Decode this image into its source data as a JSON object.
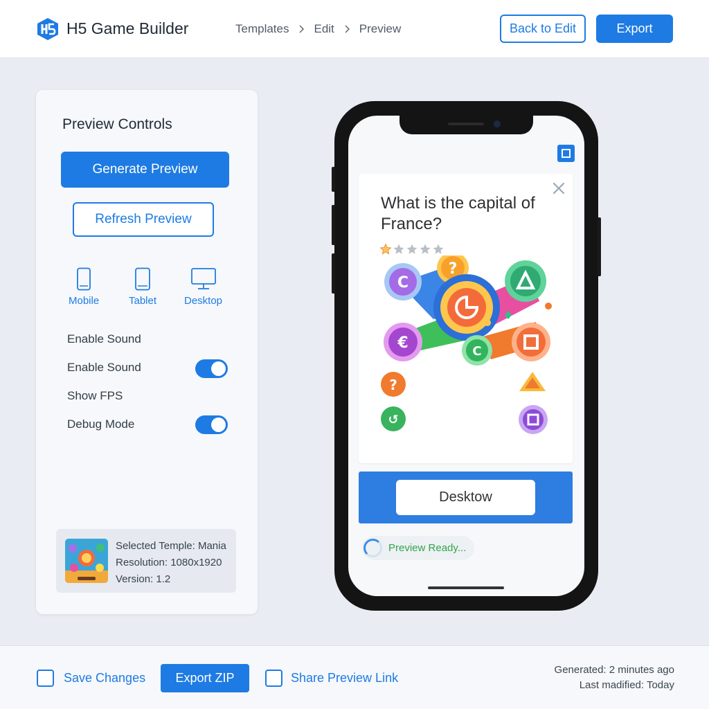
{
  "header": {
    "app_title": "H5 Game Builder",
    "logo_text": "H5",
    "breadcrumb": [
      "Templates",
      "Edit",
      "Preview"
    ],
    "back_button": "Back to Edit",
    "export_button": "Export"
  },
  "sidebar": {
    "title": "Preview Controls",
    "generate_button": "Generate Preview",
    "refresh_button": "Refresh Preview",
    "devices": [
      {
        "label": "Mobile",
        "icon": "mobile-icon"
      },
      {
        "label": "Tablet",
        "icon": "tablet-icon"
      },
      {
        "label": "Desktop",
        "icon": "desktop-icon"
      }
    ],
    "toggles": [
      {
        "label": "Enable Sound",
        "switch": false
      },
      {
        "label": "Enable Sound",
        "switch": true,
        "on": true
      },
      {
        "label": "Show FPS",
        "switch": false
      },
      {
        "label": "Debug Mode",
        "switch": true,
        "on": true
      }
    ],
    "info": {
      "selected_template": "Selected Templе: Mania",
      "resolution": "Resolution: 1080x1920",
      "version": "Version: 1.2"
    }
  },
  "preview": {
    "question": "What is the capital of France?",
    "rating": {
      "value": 1,
      "max": 5
    },
    "cta_button": "Desktow",
    "status": "Preview Ready..."
  },
  "footer": {
    "save_changes": "Save Changes",
    "export_zip": "Export ZIP",
    "share_link": "Share Preview Link",
    "generated": "Generated: 2 minutes ago",
    "last_modified": "Last madified: Today"
  },
  "colors": {
    "accent": "#1e7be3",
    "success": "#2fa34a",
    "background": "#e9edf3"
  }
}
